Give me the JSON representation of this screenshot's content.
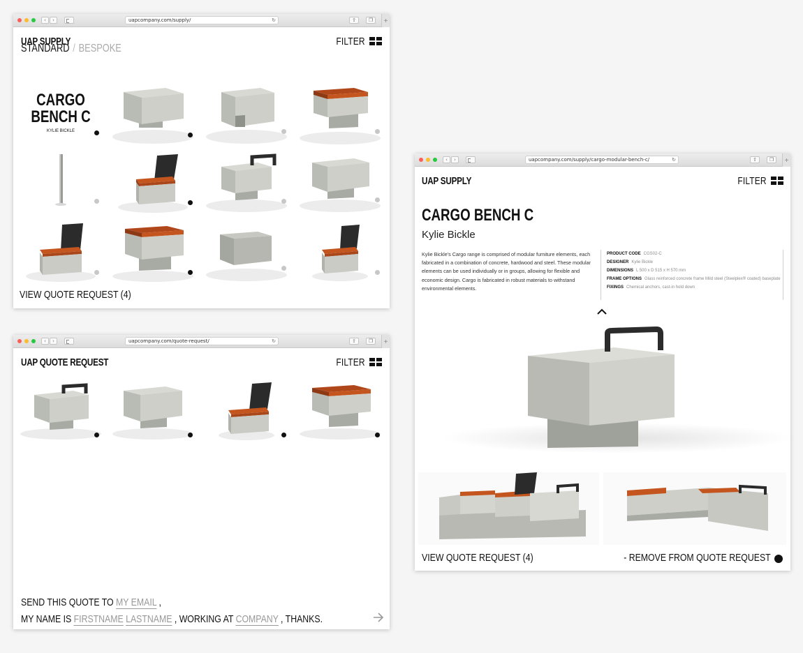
{
  "window1": {
    "url": "uapcompany.com/supply/",
    "logo": "UAP SUPPLY",
    "filter_label": "FILTER",
    "tabs": [
      {
        "label": "STANDARD",
        "active": true
      },
      {
        "label": "BESPOKE",
        "active": false
      }
    ],
    "tab_separator": "/",
    "featured": {
      "title_line1": "CARGO",
      "title_line2": "BENCH C",
      "designer": "KYLIE BICKLE"
    },
    "items": [
      {
        "type": "featured-text",
        "selected": true
      },
      {
        "type": "block-cube",
        "selected": true
      },
      {
        "type": "block-notch",
        "selected": false
      },
      {
        "type": "block-timber-top",
        "selected": false
      },
      {
        "type": "bollard-post",
        "selected": false
      },
      {
        "type": "chair-mesh-back",
        "selected": true
      },
      {
        "type": "block-handle",
        "selected": false
      },
      {
        "type": "block-cube",
        "selected": false
      },
      {
        "type": "chair-mesh-back",
        "selected": false
      },
      {
        "type": "block-timber-top",
        "selected": true
      },
      {
        "type": "block-low",
        "selected": false
      },
      {
        "type": "chair-mesh-back-small",
        "selected": false
      }
    ],
    "footer_link": "VIEW QUOTE REQUEST (4)"
  },
  "window2": {
    "url": "uapcompany.com/quote-request/",
    "logo": "UAP QUOTE REQUEST",
    "filter_label": "FILTER",
    "items": [
      {
        "type": "block-handle",
        "selected": true
      },
      {
        "type": "block-cube",
        "selected": true
      },
      {
        "type": "chair-mesh-back",
        "selected": true
      },
      {
        "type": "block-timber-top",
        "selected": true
      }
    ],
    "form": {
      "line1_prefix": "SEND THIS QUOTE TO",
      "email_placeholder": "MY EMAIL",
      "line1_suffix": ",",
      "line2_prefix": "MY NAME IS",
      "firstname_placeholder": "FIRSTNAME",
      "lastname_placeholder": "LASTNAME",
      "line2_middle": ", WORKING AT",
      "company_placeholder": "COMPANY",
      "line2_suffix": ", THANKS.",
      "submit_icon": "arrow-right-icon"
    }
  },
  "window3": {
    "url": "uapcompany.com/supply/cargo-modular-bench-c/",
    "logo": "UAP SUPPLY",
    "filter_label": "FILTER",
    "product_title": "CARGO BENCH C",
    "designer_name": "Kylie Bickle",
    "description": "Kylie Bickle's Cargo range is comprised of modular furniture elements, each fabricated in a combination of concrete, hardwood and steel. These modular elements can be used individually or in groups, allowing for flexible and economic design. Cargo is fabricated in robust materials to withstand environmental elements.",
    "specs": [
      {
        "label": "PRODUCT CODE",
        "value": "CGS02-C"
      },
      {
        "label": "DESIGNER",
        "value": "Kylie Bickle"
      },
      {
        "label": "DIMENSIONS",
        "value": "L 500 x D 515 x H 570 mm"
      },
      {
        "label": "FRAME OPTIONS",
        "value": "Glass reinforced concrete frame Mild steel (Steelplex® coated) baseplate"
      },
      {
        "label": "FIXINGS",
        "value": "Chemical anchors, cast-in hold down"
      }
    ],
    "collapse_icon": "chevron-up-icon",
    "footer_link": "VIEW QUOTE REQUEST (4)",
    "remove_label": "- REMOVE FROM QUOTE REQUEST"
  },
  "colors": {
    "concrete": "#c9cbc4",
    "timber": "#c4551e",
    "steel": "#2b2b2b",
    "selected_dot": "#111111",
    "unselected_dot": "#c7c7c7"
  }
}
